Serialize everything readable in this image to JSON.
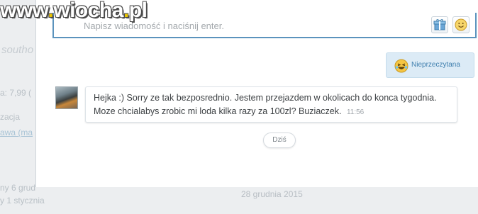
{
  "background": {
    "left_texts": [
      "southo",
      "a: 7,99 (",
      "zacja",
      "awa (ma",
      "ny 6 grud",
      "y 1 stycznia"
    ],
    "date": "28 grudnia 2015"
  },
  "composer": {
    "placeholder": "Napisz wiadomość i naciśnij enter.",
    "gift_icon": "gift-icon",
    "smile_icon": "smiley-icon"
  },
  "unread_badge": {
    "label": "Nieprzeczytana",
    "icon": "laughing-emoji-icon"
  },
  "message": {
    "text": "Hejka :) Sorry ze tak bezposrednio. Jestem przejazdem w okolicach do konca tygodnia. Moze chcialabys zrobic mi loda kilka razy za 100zl? Buziaczek.",
    "time": "11:56"
  },
  "day_separator": "Dziś",
  "watermark": {
    "www": "www",
    "site": "wiocha",
    "tld": "pl"
  },
  "colors": {
    "accent": "#5b93bd",
    "unread_bg": "#dcebf6",
    "unread_text": "#3f7fae"
  }
}
